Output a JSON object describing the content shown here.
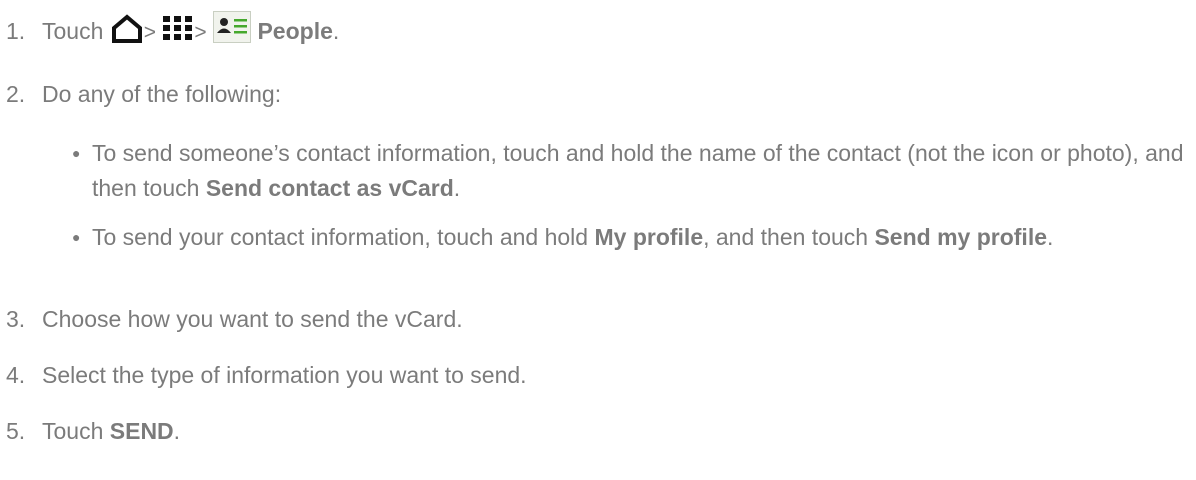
{
  "steps": [
    {
      "number": "1.",
      "prefix": "Touch",
      "sep1": ">",
      "sep2": ">",
      "bold": "People",
      "end": ".",
      "icons": [
        "home-icon",
        "all-apps-icon",
        "people-app-icon"
      ]
    },
    {
      "number": "2.",
      "text": "Do any of the following:"
    },
    {
      "number": "3.",
      "text": "Choose how you want to send the vCard."
    },
    {
      "number": "4.",
      "text": "Select the type of information you want to send."
    },
    {
      "number": "5.",
      "prefix": "Touch",
      "bold": "SEND",
      "end": "."
    }
  ],
  "bullets": [
    {
      "text1": "To send someone’s contact information, touch and hold the name of the contact (not the icon or photo), and then touch",
      "bold1": "Send contact as vCard",
      "end": "."
    },
    {
      "text1": "To send your contact information, touch and hold",
      "bold1": "My profile",
      "text2": ", and then touch",
      "bold2": "Send my profile",
      "end": "."
    }
  ],
  "colors": {
    "text": "#7b7b7b",
    "icon_dark": "#111111",
    "icon_green": "#45a82d"
  }
}
